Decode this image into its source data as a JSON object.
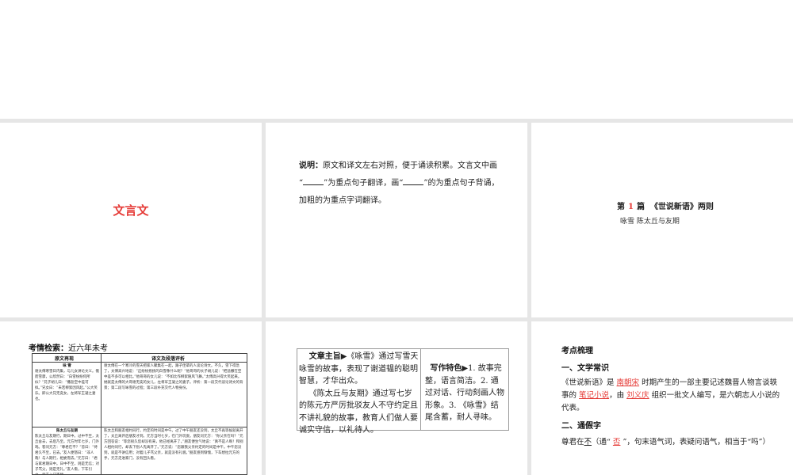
{
  "slide1": {
    "title": "文言文"
  },
  "slide2": {
    "label": "说明：",
    "line1": "原文和译文左右对照，便于诵读积累。文言文中画",
    "q_open": "“",
    "part2": "”为重点句子翻译，画“",
    "part3": "”的为重点句子背诵，",
    "line3": "加粗的为重点字词翻译。"
  },
  "slide3": {
    "di": "第",
    "num": "1",
    "pian": "篇",
    "title": "《世说新语》两则",
    "subtitle": "咏雪  陈太丘与友期"
  },
  "slide4": {
    "label": "考情检索：",
    "label_value": "近六年未考",
    "col1": "原文再现",
    "col2": "译文及段落评析",
    "r1_title": "咏 雪",
    "r1_left": "谢太傅寒雪日内集，与儿女讲论文义。俄而雪骤，公欣然曰：“白雪纷纷何所似？”兄子胡儿曰：“撒盐空中差可拟。”兄女曰：“未若柳絮因风起。”公大笑乐。即公大兄无奕女，左将军王凝之妻也。",
    "r1_right": "谢太傅在一个寒冷的雪天把家人聚集在一起，跟子侄辈的人谈论诗文。不久，雪下得急了，太傅高兴地说：“这纷纷扬扬的白雪像什么呢？”他哥哥的长子胡儿说：“把盐撒在空中差不多可以相比。”他哥哥的女儿说：“不如比作柳絮随风飞舞。”太傅高兴得大笑起来。她就是太傅的大哥谢无奕的女儿，左将军王凝之的妻子。评析：第一段交代谈论诗文的背景；第二段写咏雪的过程；第三段补充交代人物身份。",
    "r2_title": "陈太丘与友期",
    "r2_left": "陈太丘与友期行，期日中。过中不至，太丘舍去，去后乃至。元方时年七岁，门外戏。客问元方：“尊君在不？”答曰：“待君久不至，已去。”友人便怒曰：“非人哉！与人期行，相委而去。”元方曰：“君与家君期日中。日中不至，则是无信；对子骂父，则是无礼。”友人惭，下车引之。元方入门不顾。",
    "r2_right": "陈太丘和朋友相约同行，约定的时间是中午。过了中午朋友还没到，太丘不再等候就离开了，太丘离开后朋友才到。元方当时七岁，在门外玩耍。朋友问元方：“你父亲在吗？”元方回答说：“等您很久您却没有来，他已经离开了。”朋友便生气地说：“真不是人啊！和别人相约同行，却丢下别人先离开了。”元方说：“您跟我父亲约定的时间是中午。中午您没到，就是不讲信用；对着儿子骂父亲，就是没有礼貌。”朋友感到惭愧，下车想拉元方的手，元方走进家门，没有回头看。"
  },
  "slide5": {
    "theme_label": "文章主旨▶",
    "theme_p1": "《咏雪》通过写雪天咏雪的故事，表现了谢道韫的聪明智慧，才华出众。",
    "theme_p2": "《陈太丘与友期》通过写七岁的陈元方严厉批驳友人不守约定且不讲礼貌的故事，教育人们做人要诚实守信，以礼待人。",
    "feature_label": "写作特色▶",
    "feature_text": "1. 故事完整，语言简洁。2. 通过对话、行动刻画人物形象。3. 《咏雪》结尾含蓄，耐人寻味。"
  },
  "slide6": {
    "title": "考点梳理",
    "h1": "一、文学常识",
    "p1_a": "《世说新语》是",
    "p1_ans1": "南朝宋",
    "p1_b": "时期产生的一部主要记述魏晋人物言谈轶事的",
    "p1_ans2": "笔记小说",
    "p1_c": "，由",
    "p1_ans3": "刘义庆",
    "p1_d": "组织一批文人编写，是六朝志人小说的代表。",
    "h2": "二、通假字",
    "p2_a": "尊君在",
    "p2_word": "不",
    "p2_b": "（通“",
    "p2_ans": "否",
    "p2_c": "”，句末语气词，表疑问语气，相当于“吗”）"
  }
}
